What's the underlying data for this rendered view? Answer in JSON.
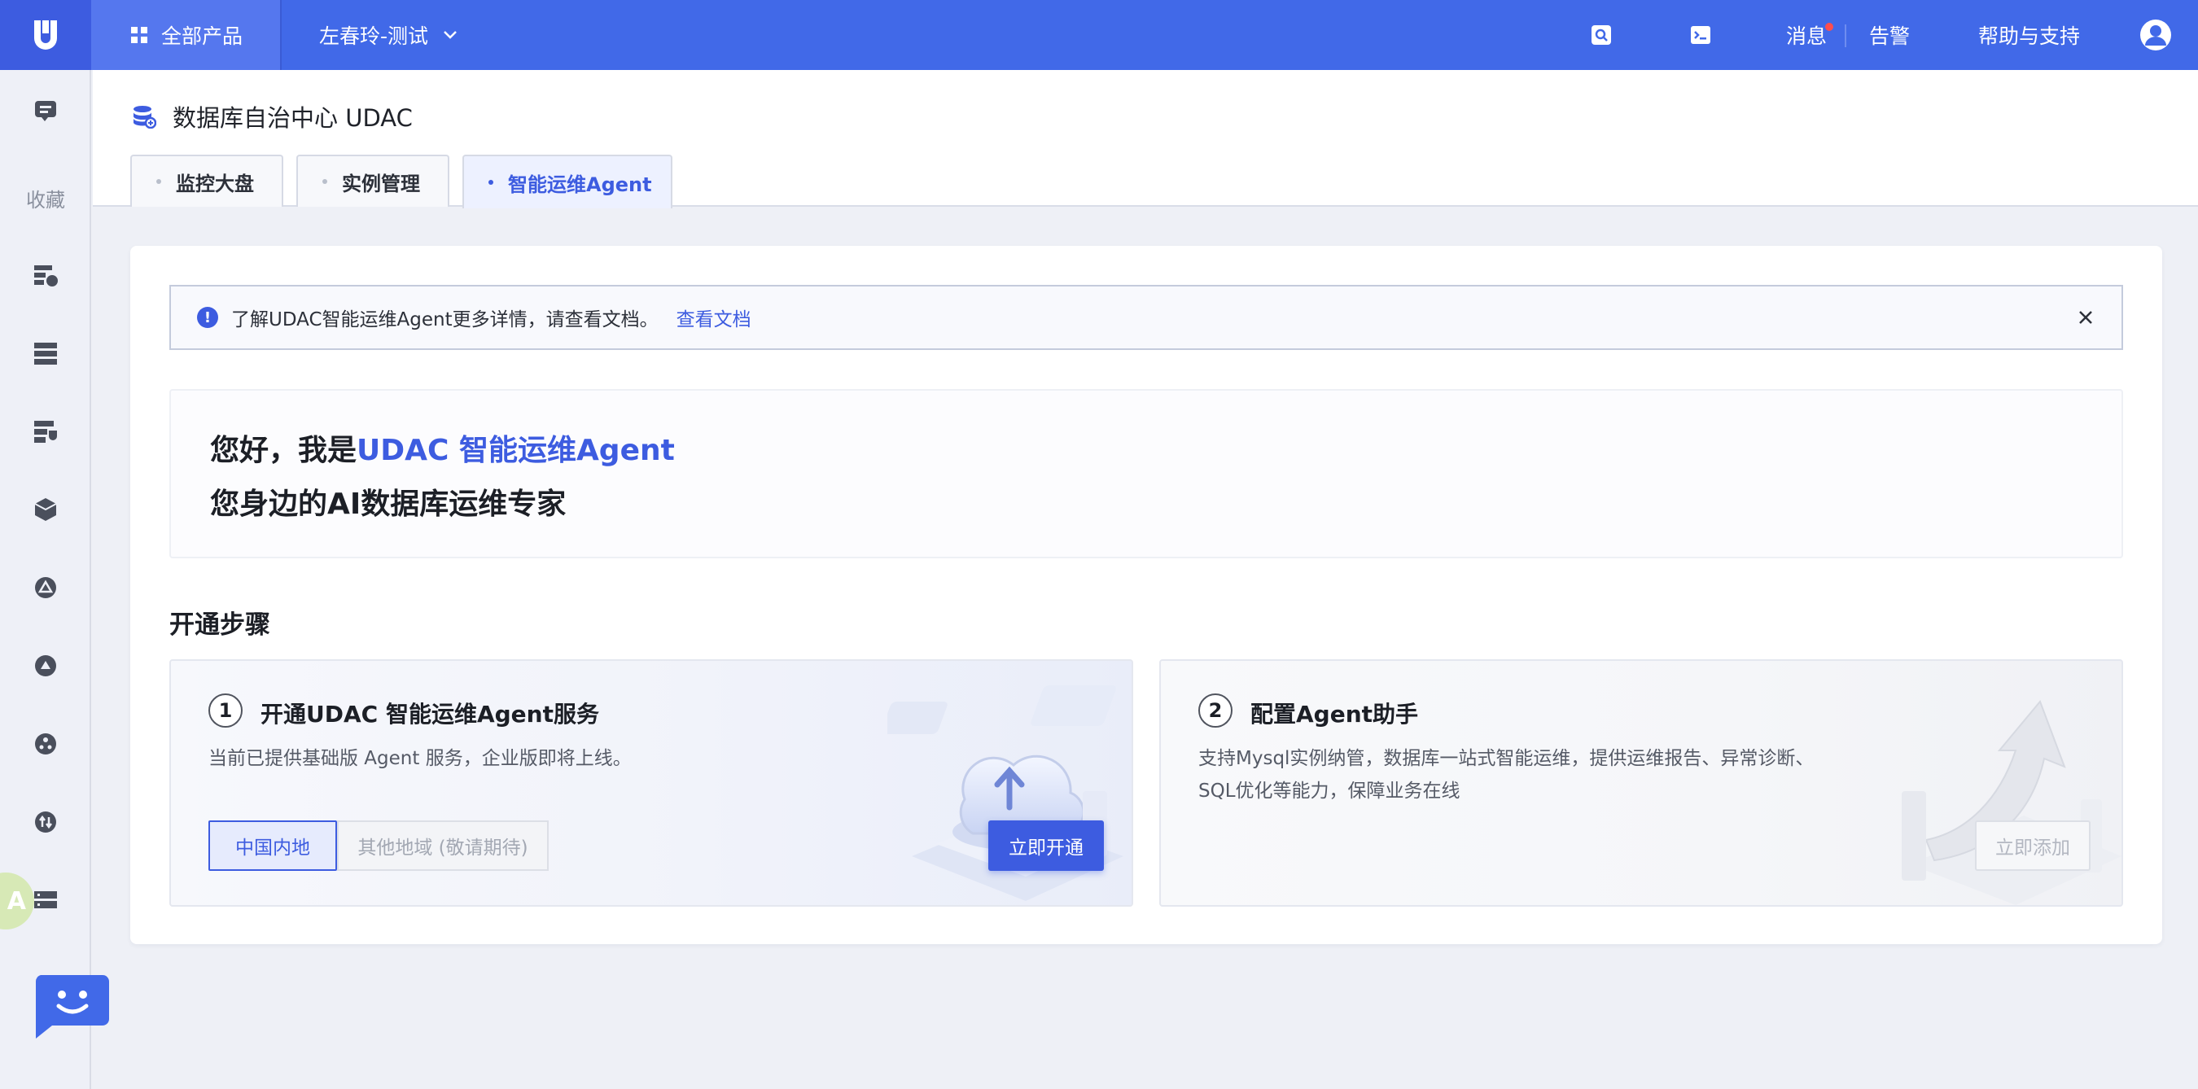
{
  "topbar": {
    "products_label": "全部产品",
    "project_label": "左春玲-测试",
    "messages_label": "消息",
    "alerts_label": "告警",
    "help_label": "帮助与支持"
  },
  "rail": {
    "logo_text": "U",
    "favorites_label": "收藏",
    "translate_text": "A"
  },
  "header": {
    "title": "数据库自治中心 UDAC",
    "tabs": [
      {
        "label": "监控大盘"
      },
      {
        "label": "实例管理"
      },
      {
        "label": "智能运维Agent"
      }
    ]
  },
  "notice": {
    "text": "了解UDAC智能运维Agent更多详情，请查看文档。",
    "link_label": "查看文档"
  },
  "hero": {
    "prefix": "您好，我是",
    "highlight": "UDAC 智能运维Agent",
    "line2": "您身边的AI数据库运维专家"
  },
  "steps": {
    "title": "开通步骤",
    "items": [
      {
        "num": "1",
        "title": "开通UDAC 智能运维Agent服务",
        "desc": "当前已提供基础版 Agent 服务，企业版即将上线。",
        "region_cn": "中国内地",
        "region_other": "其他地域 (敬请期待)",
        "action": "立即开通"
      },
      {
        "num": "2",
        "title": "配置Agent助手",
        "desc": "支持Mysql实例纳管，数据库一站式智能运维，提供运维报告、异常诊断、SQL优化等能力，保障业务在线",
        "action": "立即添加"
      }
    ]
  },
  "colors": {
    "brand": "#3d5ce0",
    "topbar": "#4169e8",
    "notice_dot": "#ff4d4f"
  }
}
